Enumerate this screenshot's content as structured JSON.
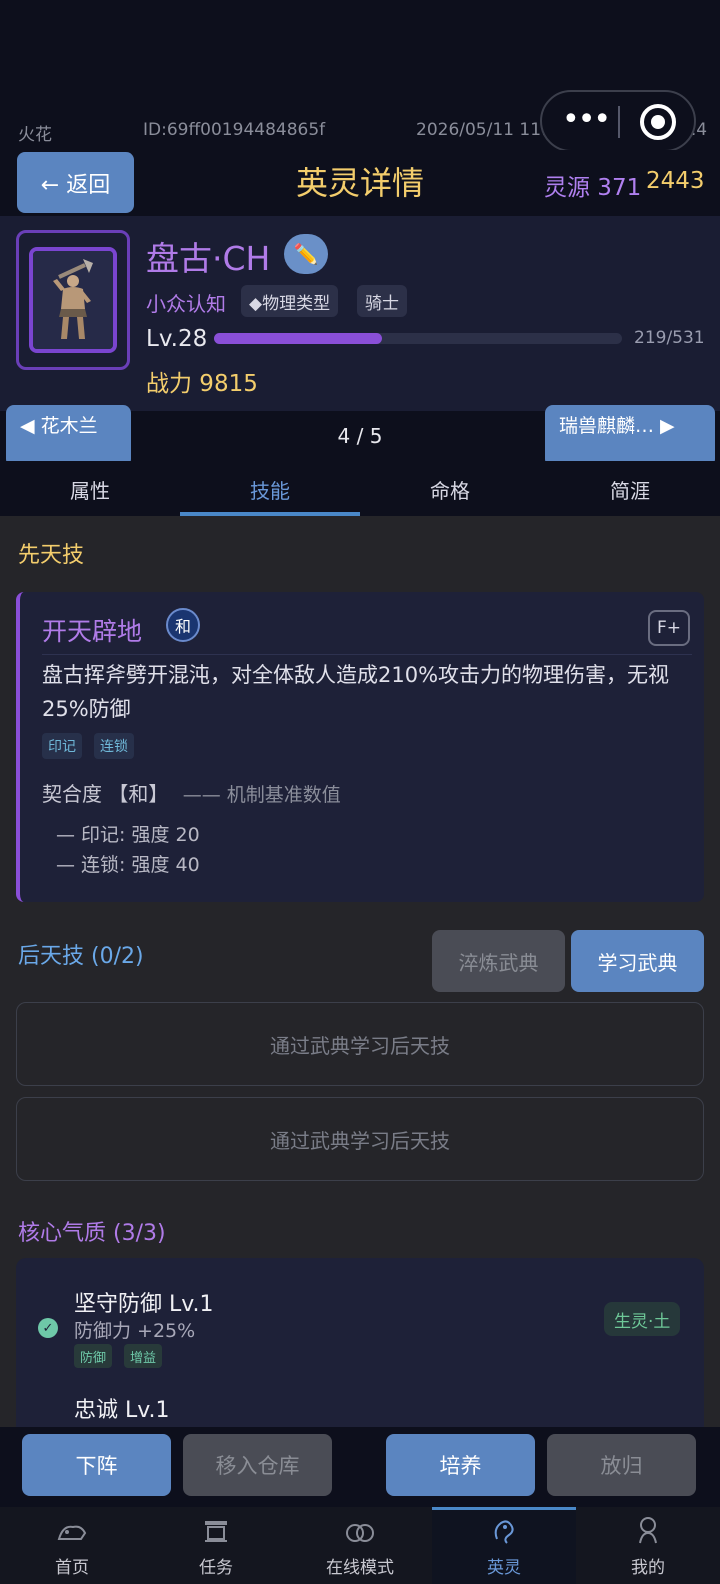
{
  "status": {
    "app_name": "火花",
    "id_text": "ID:69ff00194484865f",
    "datetime": "2026/05/11 11:42",
    "version": "4.4"
  },
  "header": {
    "back_label": "← 返回",
    "title": "英灵详情",
    "resource_label": "灵源 371",
    "gold_value": "2443"
  },
  "hero": {
    "name": "盘古·CH",
    "rarity": "小众认知",
    "tags": [
      "◆物理类型",
      "骑士"
    ],
    "level_label": "Lv.28",
    "xp_text": "219/531",
    "xp_fraction": 0.4124,
    "power_label": "战力 9815"
  },
  "nav": {
    "prev_label": "◀ 花木兰",
    "next_label": "瑞兽麒麟… ▶",
    "pager": "4 / 5"
  },
  "tabs": [
    "属性",
    "技能",
    "命格",
    "简涯"
  ],
  "active_tab": 1,
  "innate": {
    "section_title": "先天技",
    "skill_name": "开天辟地",
    "seal_char": "和",
    "grade": "F+",
    "description": "盘古挥斧劈开混沌，对全体敌人造成210%攻击力的物理伤害，无视25%防御",
    "tags": [
      "印记",
      "连锁"
    ],
    "fit_label": "契合度 【和】",
    "fit_sub": "—— 机制基准数值",
    "fit_lines": [
      "— 印记: 强度 20",
      "— 连锁: 强度 40"
    ]
  },
  "acquired": {
    "section_title": "后天技 (0/2)",
    "refine_label": "淬炼武典",
    "learn_label": "学习武典",
    "slots": [
      "通过武典学习后天技",
      "通过武典学习后天技"
    ]
  },
  "traits": {
    "section_title": "核心气质 (3/3)",
    "items": [
      {
        "name": "坚守防御 Lv.1",
        "effect": "防御力 +25%",
        "badge": "生灵·土",
        "tags": [
          "防御",
          "增益"
        ]
      },
      {
        "name": "忠诚 Lv.1"
      }
    ]
  },
  "actions": {
    "unassign": "下阵",
    "move": "移入仓库",
    "train": "培养",
    "release": "放归"
  },
  "bottom_nav": [
    "首页",
    "任务",
    "在线模式",
    "英灵",
    "我的"
  ],
  "colors": {
    "accent_blue": "#5b85c0",
    "gold": "#f3cd6c",
    "purple": "#b07be8",
    "bg_dark": "#0d0f1c"
  }
}
